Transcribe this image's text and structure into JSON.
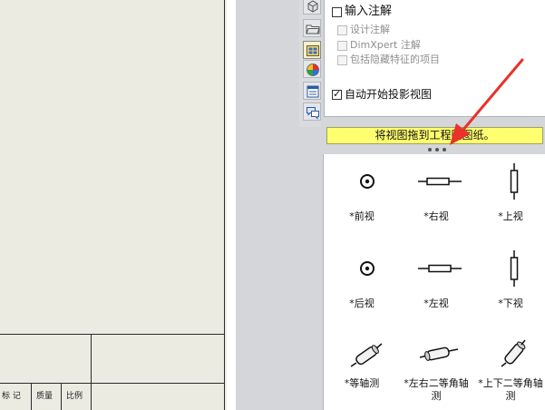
{
  "drawing": {
    "title_block": {
      "labels": [
        "标 记",
        "质量",
        "比例"
      ]
    }
  },
  "toolbar_tabs": [
    {
      "icon": "part-icon"
    },
    {
      "icon": "folder-icon"
    },
    {
      "icon": "view-palette-icon"
    },
    {
      "icon": "appearance-icon"
    },
    {
      "icon": "property-list-icon"
    },
    {
      "icon": "callout-icon"
    }
  ],
  "options": {
    "import_annotations": {
      "label": "输入注解",
      "checked": false
    },
    "design_annotations": {
      "label": "设计注解",
      "checked": false,
      "disabled": true
    },
    "dimxpert_annotations": {
      "label": "DimXpert 注解",
      "checked": false,
      "disabled": true
    },
    "hidden_features": {
      "label": "包括隐藏特征的项目",
      "checked": false,
      "disabled": true
    },
    "auto_projected_view": {
      "label": "自动开始投影视图",
      "checked": true
    }
  },
  "hint": {
    "text": "将视图拖到工程图图纸。"
  },
  "views": [
    {
      "label": "*前视",
      "icon": "front-view-icon"
    },
    {
      "label": "*右视",
      "icon": "right-view-icon"
    },
    {
      "label": "*上视",
      "icon": "top-view-icon"
    },
    {
      "label": "*后视",
      "icon": "back-view-icon"
    },
    {
      "label": "*左视",
      "icon": "left-view-icon"
    },
    {
      "label": "*下视",
      "icon": "bottom-view-icon"
    },
    {
      "label": "*等轴测",
      "icon": "isometric-view-icon"
    },
    {
      "label": "*左右二等角轴测",
      "icon": "dimetric-lr-view-icon"
    },
    {
      "label": "*上下二等角轴测",
      "icon": "dimetric-tb-view-icon"
    }
  ],
  "colors": {
    "annotation_arrow": "#e8322a",
    "hint_background": "#ffff70"
  }
}
